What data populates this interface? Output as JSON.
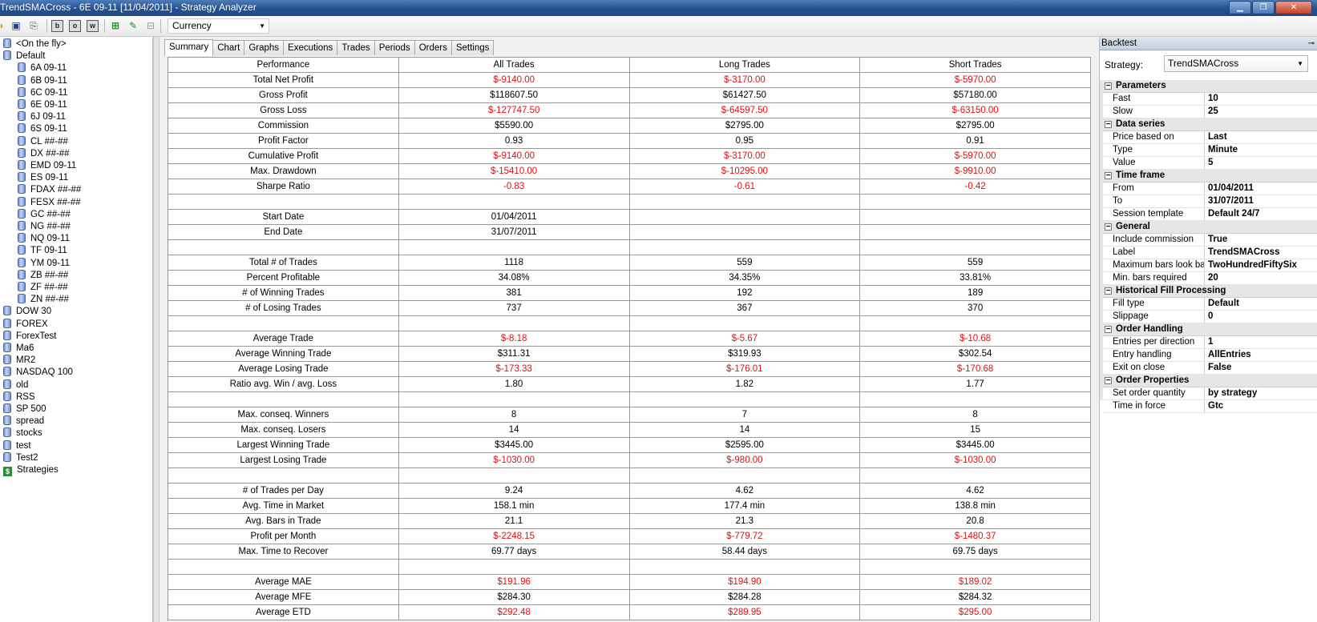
{
  "window": {
    "title": "TrendSMACross - 6E 09-11 [11/04/2011] - Strategy Analyzer",
    "controls": [
      "▁",
      "❐",
      "✕"
    ]
  },
  "toolbar": {
    "instrument_combo": "Currency",
    "box_icons": [
      "b",
      "o",
      "w"
    ]
  },
  "tree": {
    "items": [
      {
        "label": "<On the fly>",
        "indent": 0,
        "icon": "database-icon"
      },
      {
        "label": "Default",
        "indent": 0,
        "icon": "database-icon"
      },
      {
        "label": "6A 09-11",
        "indent": 1,
        "icon": "database-icon"
      },
      {
        "label": "6B 09-11",
        "indent": 1,
        "icon": "database-icon"
      },
      {
        "label": "6C 09-11",
        "indent": 1,
        "icon": "database-icon"
      },
      {
        "label": "6E 09-11",
        "indent": 1,
        "icon": "database-icon"
      },
      {
        "label": "6J 09-11",
        "indent": 1,
        "icon": "database-icon"
      },
      {
        "label": "6S 09-11",
        "indent": 1,
        "icon": "database-icon"
      },
      {
        "label": "CL ##-##",
        "indent": 1,
        "icon": "database-icon"
      },
      {
        "label": "DX ##-##",
        "indent": 1,
        "icon": "database-icon"
      },
      {
        "label": "EMD 09-11",
        "indent": 1,
        "icon": "database-icon"
      },
      {
        "label": "ES 09-11",
        "indent": 1,
        "icon": "database-icon"
      },
      {
        "label": "FDAX ##-##",
        "indent": 1,
        "icon": "database-icon"
      },
      {
        "label": "FESX ##-##",
        "indent": 1,
        "icon": "database-icon"
      },
      {
        "label": "GC ##-##",
        "indent": 1,
        "icon": "database-icon"
      },
      {
        "label": "NG ##-##",
        "indent": 1,
        "icon": "database-icon"
      },
      {
        "label": "NQ 09-11",
        "indent": 1,
        "icon": "database-icon"
      },
      {
        "label": "TF 09-11",
        "indent": 1,
        "icon": "database-icon"
      },
      {
        "label": "YM 09-11",
        "indent": 1,
        "icon": "database-icon"
      },
      {
        "label": "ZB ##-##",
        "indent": 1,
        "icon": "database-icon"
      },
      {
        "label": "ZF ##-##",
        "indent": 1,
        "icon": "database-icon"
      },
      {
        "label": "ZN ##-##",
        "indent": 1,
        "icon": "database-icon"
      },
      {
        "label": "DOW 30",
        "indent": 0,
        "icon": "database-icon"
      },
      {
        "label": "FOREX",
        "indent": 0,
        "icon": "database-icon"
      },
      {
        "label": "ForexTest",
        "indent": 0,
        "icon": "database-icon"
      },
      {
        "label": "Ma6",
        "indent": 0,
        "icon": "database-icon"
      },
      {
        "label": "MR2",
        "indent": 0,
        "icon": "database-icon"
      },
      {
        "label": "NASDAQ 100",
        "indent": 0,
        "icon": "database-icon"
      },
      {
        "label": "old",
        "indent": 0,
        "icon": "database-icon"
      },
      {
        "label": "RSS",
        "indent": 0,
        "icon": "database-icon"
      },
      {
        "label": "SP 500",
        "indent": 0,
        "icon": "database-icon"
      },
      {
        "label": "spread",
        "indent": 0,
        "icon": "database-icon"
      },
      {
        "label": "stocks",
        "indent": 0,
        "icon": "database-icon"
      },
      {
        "label": "test",
        "indent": 0,
        "icon": "database-icon"
      },
      {
        "label": "Test2",
        "indent": 0,
        "icon": "database-icon"
      },
      {
        "label": "Strategies",
        "indent": 0,
        "icon": "dollar-icon"
      }
    ]
  },
  "tabs": [
    "Summary",
    "Chart",
    "Graphs",
    "Executions",
    "Trades",
    "Periods",
    "Orders",
    "Settings"
  ],
  "active_tab": "Summary",
  "summary": {
    "columns": [
      "Performance",
      "All Trades",
      "Long Trades",
      "Short Trades"
    ],
    "rows": [
      [
        "Total Net Profit",
        "$-9140.00",
        "$-3170.00",
        "$-5970.00"
      ],
      [
        "Gross Profit",
        "$118607.50",
        "$61427.50",
        "$57180.00"
      ],
      [
        "Gross Loss",
        "$-127747.50",
        "$-64597.50",
        "$-63150.00"
      ],
      [
        "Commission",
        "$5590.00",
        "$2795.00",
        "$2795.00"
      ],
      [
        "Profit Factor",
        "0.93",
        "0.95",
        "0.91"
      ],
      [
        "Cumulative Profit",
        "$-9140.00",
        "$-3170.00",
        "$-5970.00"
      ],
      [
        "Max. Drawdown",
        "$-15410.00",
        "$-10295.00",
        "$-9910.00"
      ],
      [
        "Sharpe Ratio",
        "-0.83",
        "-0.61",
        "-0.42"
      ],
      [
        "",
        "",
        "",
        ""
      ],
      [
        "Start Date",
        "01/04/2011",
        "",
        ""
      ],
      [
        "End Date",
        "31/07/2011",
        "",
        ""
      ],
      [
        "",
        "",
        "",
        ""
      ],
      [
        "Total # of Trades",
        "1118",
        "559",
        "559"
      ],
      [
        "Percent Profitable",
        "34.08%",
        "34.35%",
        "33.81%"
      ],
      [
        "# of Winning Trades",
        "381",
        "192",
        "189"
      ],
      [
        "# of Losing Trades",
        "737",
        "367",
        "370"
      ],
      [
        "",
        "",
        "",
        ""
      ],
      [
        "Average Trade",
        "$-8.18",
        "$-5.67",
        "$-10.68"
      ],
      [
        "Average Winning Trade",
        "$311.31",
        "$319.93",
        "$302.54"
      ],
      [
        "Average Losing Trade",
        "$-173.33",
        "$-176.01",
        "$-170.68"
      ],
      [
        "Ratio avg. Win / avg. Loss",
        "1.80",
        "1.82",
        "1.77"
      ],
      [
        "",
        "",
        "",
        ""
      ],
      [
        "Max. conseq. Winners",
        "8",
        "7",
        "8"
      ],
      [
        "Max. conseq. Losers",
        "14",
        "14",
        "15"
      ],
      [
        "Largest Winning Trade",
        "$3445.00",
        "$2595.00",
        "$3445.00"
      ],
      [
        "Largest Losing Trade",
        "$-1030.00",
        "$-980.00",
        "$-1030.00"
      ],
      [
        "",
        "",
        "",
        ""
      ],
      [
        "# of Trades per Day",
        "9.24",
        "4.62",
        "4.62"
      ],
      [
        "Avg. Time in Market",
        "158.1 min",
        "177.4 min",
        "138.8 min"
      ],
      [
        "Avg. Bars in Trade",
        "21.1",
        "21.3",
        "20.8"
      ],
      [
        "Profit per Month",
        "$-2248.15",
        "$-779.72",
        "$-1480.37"
      ],
      [
        "Max. Time to Recover",
        "69.77 days",
        "58.44 days",
        "69.75 days"
      ],
      [
        "",
        "",
        "",
        ""
      ],
      [
        "Average MAE",
        "$191.96",
        "$194.90",
        "$189.02"
      ],
      [
        "Average MFE",
        "$284.30",
        "$284.28",
        "$284.32"
      ],
      [
        "Average ETD",
        "$292.48",
        "$289.95",
        "$295.00"
      ]
    ],
    "red_rows": [
      "Total Net Profit",
      "Gross Loss",
      "Cumulative Profit",
      "Max. Drawdown",
      "Sharpe Ratio",
      "Average Trade",
      "Average Losing Trade",
      "Largest Losing Trade",
      "Profit per Month",
      "Average MAE",
      "Average ETD"
    ],
    "negative_color": "#e01010"
  },
  "backtest": {
    "title": "Backtest",
    "strategy_label": "Strategy:",
    "strategy_value": "TrendSMACross",
    "categories": [
      {
        "name": "Parameters",
        "props": [
          [
            "Fast",
            "10"
          ],
          [
            "Slow",
            "25"
          ]
        ]
      },
      {
        "name": "Data series",
        "props": [
          [
            "Price based on",
            "Last"
          ],
          [
            "Type",
            "Minute"
          ],
          [
            "Value",
            "5"
          ]
        ]
      },
      {
        "name": "Time frame",
        "props": [
          [
            "From",
            "01/04/2011"
          ],
          [
            "To",
            "31/07/2011"
          ],
          [
            "Session template",
            "Default 24/7"
          ]
        ]
      },
      {
        "name": "General",
        "props": [
          [
            "Include commission",
            "True"
          ],
          [
            "Label",
            "TrendSMACross"
          ],
          [
            "Maximum bars look back",
            "TwoHundredFiftySix"
          ],
          [
            "Min. bars required",
            "20"
          ]
        ]
      },
      {
        "name": "Historical Fill Processing",
        "props": [
          [
            "Fill type",
            "Default"
          ],
          [
            "Slippage",
            "0"
          ]
        ]
      },
      {
        "name": "Order Handling",
        "props": [
          [
            "Entries per direction",
            "1"
          ],
          [
            "Entry handling",
            "AllEntries"
          ],
          [
            "Exit on close",
            "False"
          ]
        ]
      },
      {
        "name": "Order Properties",
        "props": [
          [
            "Set order quantity",
            "by strategy"
          ],
          [
            "Time in force",
            "Gtc"
          ]
        ]
      }
    ]
  }
}
